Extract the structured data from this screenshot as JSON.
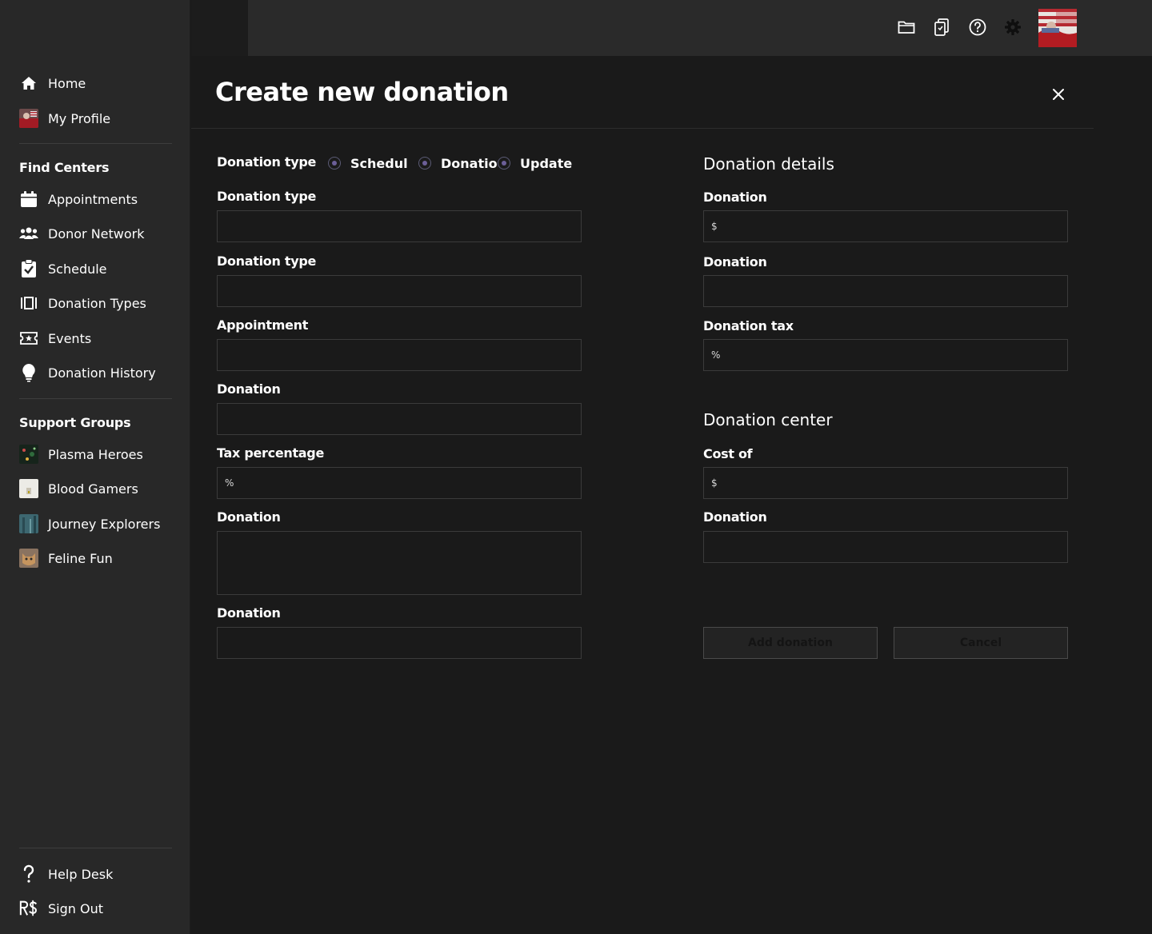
{
  "sidebar": {
    "nav": [
      {
        "label": "Home",
        "icon": "home-icon"
      },
      {
        "label": "My Profile",
        "icon": "profile-avatar"
      }
    ],
    "find_centers": {
      "heading": "Find Centers",
      "items": [
        {
          "label": "Appointments",
          "icon": "calendar-icon"
        },
        {
          "label": "Donor Network",
          "icon": "users-icon"
        },
        {
          "label": "Schedule",
          "icon": "clipboard-check-icon"
        },
        {
          "label": "Donation Types",
          "icon": "columns-icon"
        },
        {
          "label": "Events",
          "icon": "ticket-icon"
        },
        {
          "label": "Donation History",
          "icon": "lightbulb-icon"
        }
      ]
    },
    "support_groups": {
      "heading": "Support Groups",
      "items": [
        {
          "label": "Plasma Heroes",
          "thumb_color": "#1e3a2a"
        },
        {
          "label": "Blood Gamers",
          "thumb_color": "#e8e4dc"
        },
        {
          "label": "Journey Explorers",
          "thumb_color": "#3f6b74"
        },
        {
          "label": "Feline Fun",
          "thumb_color": "#b98a5a"
        }
      ]
    },
    "footer": [
      {
        "label": "Help Desk",
        "icon": "question-icon"
      },
      {
        "label": "Sign Out",
        "icon": "currency-icon"
      }
    ]
  },
  "topbar": {
    "icons": [
      "folder-icon",
      "device-icon",
      "help-circle-icon",
      "gear-icon"
    ]
  },
  "page": {
    "title": "Create new donation"
  },
  "form_left": {
    "radio_label": "Donation type",
    "radio_options": [
      "Schedul",
      "Donatio",
      "Update"
    ],
    "fields": [
      {
        "label": "Donation type",
        "value": "",
        "placeholder": ""
      },
      {
        "label": "Donation type",
        "value": "",
        "placeholder": ""
      },
      {
        "label": "Appointment",
        "value": "",
        "placeholder": ""
      },
      {
        "label": "Donation",
        "value": "",
        "placeholder": ""
      },
      {
        "label": "Tax percentage",
        "value": "",
        "prefix": "%"
      },
      {
        "label": "Donation",
        "value": ""
      },
      {
        "label": "Donation",
        "value": ""
      }
    ]
  },
  "form_right": {
    "details_title": "Donation details",
    "details_fields": [
      {
        "label": "Donation",
        "prefix": "$"
      },
      {
        "label": "Donation",
        "prefix": ""
      },
      {
        "label": "Donation tax",
        "prefix": "%"
      }
    ],
    "center_title": "Donation center",
    "center_fields": [
      {
        "label": "Cost of",
        "prefix": "$"
      },
      {
        "label": "Donation",
        "prefix": ""
      }
    ]
  },
  "actions": {
    "add_label": "Add donation",
    "cancel_label": "Cancel"
  },
  "colors": {
    "background": "#1a1a1a",
    "sidebar": "#282828",
    "topbar": "#2a2a2a",
    "radio_accent": "#6c5f98"
  }
}
